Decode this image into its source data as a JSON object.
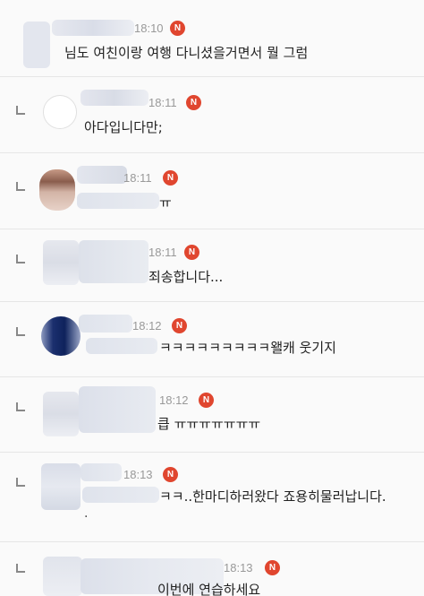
{
  "comments": [
    {
      "time": "18:10",
      "badge": "N",
      "text": "님도 여친이랑 여행 다니셨을거면서 뭘 그럼",
      "is_reply": false
    },
    {
      "time": "18:11",
      "badge": "N",
      "text": "아다입니다만;",
      "is_reply": true
    },
    {
      "time": "18:11",
      "badge": "N",
      "text": "ㅠ",
      "is_reply": true
    },
    {
      "time": "18:11",
      "badge": "N",
      "text": "죄송합니다...",
      "is_reply": true
    },
    {
      "time": "18:12",
      "badge": "N",
      "text": "ㅋㅋㅋㅋㅋㅋㅋㅋㅋ왤캐 웃기지",
      "is_reply": true
    },
    {
      "time": "18:12",
      "badge": "N",
      "text": "큽 ㅠㅠㅠㅠㅠㅠㅠ",
      "is_reply": true
    },
    {
      "time": "18:13",
      "badge": "N",
      "text": "ㅋㅋ..한마디하러왔다 죠용히물러납니다.",
      "is_reply": true,
      "extra": "."
    },
    {
      "time": "18:13",
      "badge": "N",
      "text": "이번에 연습하세요",
      "is_reply": true
    }
  ],
  "colors": {
    "badge": "#e0462f",
    "time": "#999999",
    "blur": "#dde0ea"
  }
}
